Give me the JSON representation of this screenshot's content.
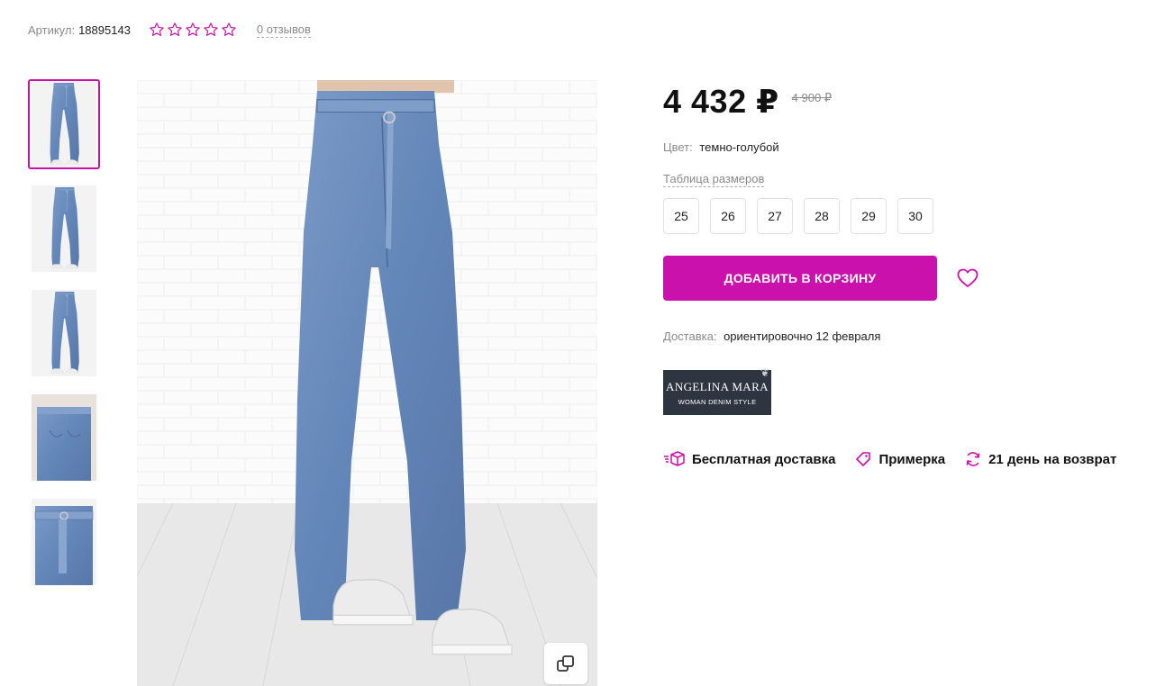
{
  "product": {
    "sku_label": "Артикул:",
    "sku_value": "18895143",
    "rating": 0,
    "rating_max": 5,
    "reviews_link": "0 отзывов"
  },
  "gallery": {
    "thumbnails": [
      "photo-front",
      "photo-front-full",
      "photo-back-full",
      "photo-back-close",
      "photo-belt-detail"
    ],
    "active_index": 0
  },
  "pricing": {
    "price": "4 432 ₽",
    "old_price": "4 900 ₽"
  },
  "color": {
    "label": "Цвет:",
    "value": "темно-голубой"
  },
  "sizes": {
    "table_link": "Таблица размеров",
    "options": [
      "25",
      "26",
      "27",
      "28",
      "29",
      "30"
    ]
  },
  "actions": {
    "add_to_cart": "ДОБАВИТЬ В КОРЗИНУ",
    "favorite_icon": "heart-icon"
  },
  "delivery": {
    "label": "Доставка:",
    "value": "ориентировочно 12 февраля"
  },
  "brand": {
    "name": "ANGELINA MARA",
    "tagline": "WOMAN DENIM STYLE"
  },
  "features": [
    {
      "icon": "delivery-box-icon",
      "label": "Бесплатная доставка"
    },
    {
      "icon": "tag-icon",
      "label": "Примерка"
    },
    {
      "icon": "refresh-icon",
      "label": "21 день на возврат"
    }
  ],
  "colors": {
    "accent": "#cb11ab",
    "denim": "#6d8fbd",
    "text": "#111111",
    "muted": "#8a8a8a"
  }
}
